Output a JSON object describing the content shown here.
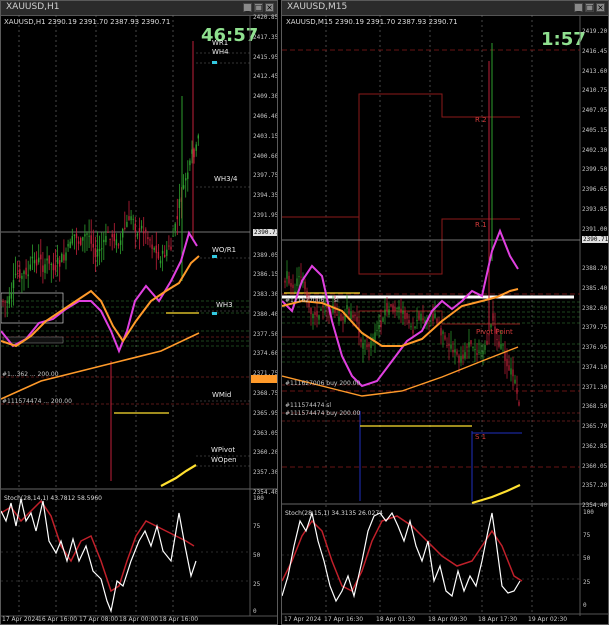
{
  "left": {
    "title": "XAUUSD,H1",
    "symbol_line": "XAUUSD,H1  2390.19 2391.70 2387.93 2390.71",
    "countdown": "46:57",
    "price_labels": [
      "2420.85",
      "2417.35",
      "2415.95",
      "2412.45",
      "2409.30",
      "2406.40",
      "2403.15",
      "2400.60",
      "2397.75",
      "2394.35",
      "2391.95",
      "2390.71",
      "2389.05",
      "2386.15",
      "2383.30",
      "2380.40",
      "2377.50",
      "2374.60",
      "2371.75",
      "2368.75",
      "2365.95",
      "2363.05",
      "2360.20",
      "2357.30",
      "2354.40"
    ],
    "current_price": "2390.71",
    "marker_price": "2368.75",
    "levels": [
      "WR1",
      "WH4",
      "WH3/4",
      "WO/R1",
      "WH3",
      "WMid",
      "WPivot",
      "WOpen"
    ],
    "orders": [
      "#1...362 ... 200.00",
      "#111574474 ... 200.00"
    ],
    "stoch_label": "Stoch(28,14,1) 43.7812 58.5960",
    "stoch_ticks": [
      "100",
      "75",
      "50",
      "25",
      "0"
    ],
    "x_labels": [
      "17 Apr 2024",
      "16 Apr 16:00",
      "17 Apr 08:00",
      "18 Apr 00:00",
      "18 Apr 16:00"
    ]
  },
  "right": {
    "title": "XAUUSD,M15",
    "symbol_line": "XAUUSD,M15  2390.19 2391.70 2387.93 2390.71",
    "countdown": "1:57",
    "price_labels": [
      "2419.20",
      "2416.45",
      "2413.60",
      "2410.75",
      "2407.95",
      "2405.15",
      "2402.30",
      "2399.50",
      "2396.65",
      "2393.85",
      "2391.00",
      "2390.71",
      "2388.20",
      "2385.40",
      "2382.60",
      "2379.75",
      "2376.95",
      "2374.10",
      "2371.30",
      "2368.50",
      "2365.70",
      "2362.85",
      "2360.05",
      "2357.20",
      "2354.40"
    ],
    "current_price": "2390.71",
    "levels": [
      "R 2",
      "R 1",
      "Pivot Point",
      "S 1"
    ],
    "orders": [
      "#111627006 ... sl",
      "#111627006 buy 200.00",
      "#111574474 sl",
      "#111574474 buy 200.00"
    ],
    "stoch_label": "Stoch(28,15,1) 34.3135 26.0274",
    "stoch_ticks": [
      "100",
      "75",
      "50",
      "25",
      "0"
    ],
    "x_labels": [
      "17 Apr 2024",
      "17 Apr 16:30",
      "18 Apr 01:30",
      "18 Apr 09:30",
      "18 Apr 17:30",
      "19 Apr 02:30"
    ]
  },
  "colors": {
    "background": "#000000",
    "candle_up": "#2e9e2e",
    "candle_down": "#c0203a",
    "ma_magenta": "#e040e0",
    "ma_orange": "#ff9a2a",
    "stoch_main": "#ffffff",
    "stoch_signal": "#c0202a",
    "pivot_red": "#8b1a1a",
    "yellow": "#ffe030"
  }
}
